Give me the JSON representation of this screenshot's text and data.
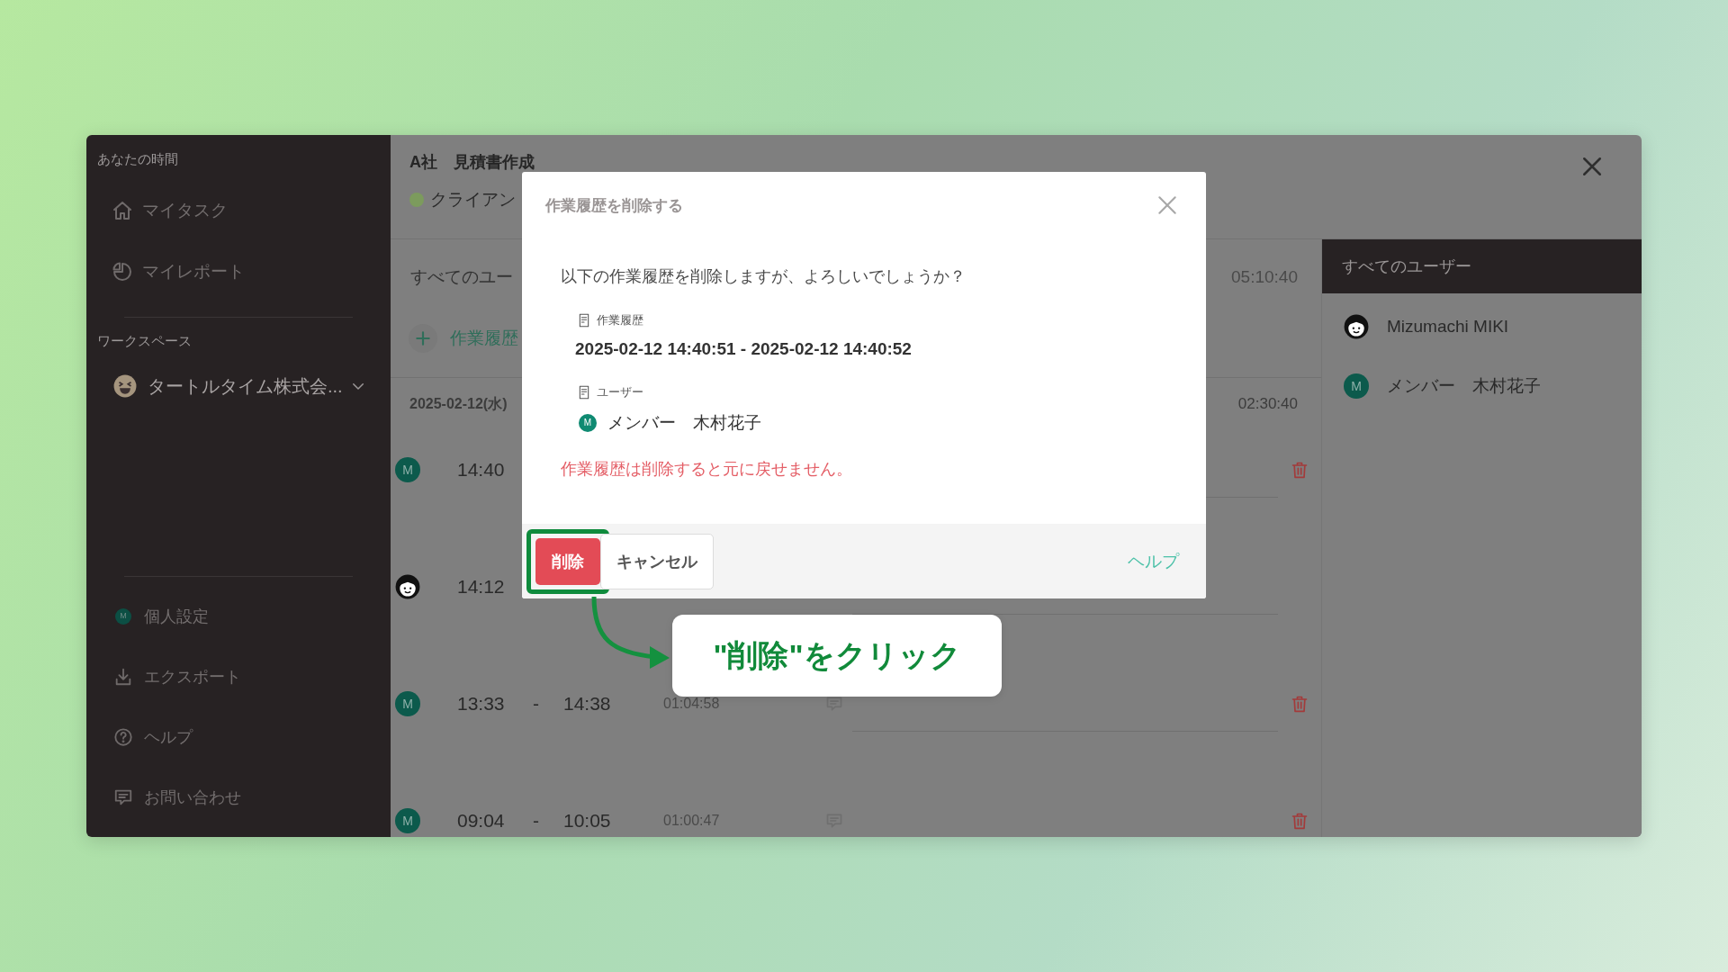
{
  "sidebar": {
    "section_title": "あなたの時間",
    "nav": [
      {
        "label": "マイタスク",
        "icon": {
          "kind": "home"
        }
      },
      {
        "label": "マイレポート",
        "icon": {
          "kind": "pie"
        }
      }
    ],
    "workspace_title": "ワークスペース",
    "workspace": {
      "name": "タートルタイム株式会..."
    },
    "footer_nav": [
      {
        "label": "個人設定",
        "icon": {
          "kind": "initial",
          "letter": "M"
        }
      },
      {
        "label": "エクスポート",
        "icon": {
          "kind": "download"
        }
      },
      {
        "label": "ヘルプ",
        "icon": {
          "kind": "help"
        }
      },
      {
        "label": "お問い合わせ",
        "icon": {
          "kind": "chat"
        }
      }
    ]
  },
  "task": {
    "title": "A社　見積書作成",
    "client": "クライアン"
  },
  "filter": {
    "label": "すべてのユー",
    "total": "05:10:40"
  },
  "add_button": {
    "label": "作業履歴"
  },
  "day": {
    "date": "2025-02-12(水)",
    "total": "02:30:40"
  },
  "entries": [
    {
      "avatar": {
        "kind": "initial",
        "letter": "M"
      },
      "start": "14:40",
      "comment": false,
      "trash": true
    },
    {
      "avatar": {
        "kind": "face"
      },
      "start": "14:12",
      "comment": false,
      "trash": false
    },
    {
      "avatar": {
        "kind": "initial",
        "letter": "M"
      },
      "start": "13:33",
      "dash": "-",
      "end": "14:38",
      "duration": "01:04:58",
      "comment": true,
      "trash": true
    },
    {
      "avatar": {
        "kind": "initial",
        "letter": "M"
      },
      "start": "09:04",
      "dash": "-",
      "end": "10:05",
      "duration": "01:00:47",
      "comment": true,
      "trash": true
    }
  ],
  "users_panel": {
    "title": "すべてのユーザー",
    "users": [
      {
        "avatar": {
          "kind": "face"
        },
        "name": "Mizumachi MIKI"
      },
      {
        "avatar": {
          "kind": "initial",
          "letter": "M"
        },
        "name": "メンバー　木村花子"
      }
    ]
  },
  "modal": {
    "title": "作業履歴を削除する",
    "message": "以下の作業履歴を削除しますが、よろしいでしょうか？",
    "fields": [
      {
        "label": "作業履歴",
        "value": "2025-02-12 14:40:51 - 2025-02-12 14:40:52"
      },
      {
        "label": "ユーザー",
        "value": "メンバー　木村花子",
        "avatar": {
          "kind": "initial",
          "letter": "M"
        }
      }
    ],
    "warning": "作業履歴は削除すると元に戻せません。",
    "buttons": [
      {
        "kind": "danger",
        "label": "削除",
        "highlighted": true
      },
      {
        "kind": "secondary",
        "label": "キャンセル",
        "highlighted": false
      }
    ],
    "help_link": "ヘルプ"
  },
  "callout": {
    "text": "\"削除\"をクリック"
  }
}
